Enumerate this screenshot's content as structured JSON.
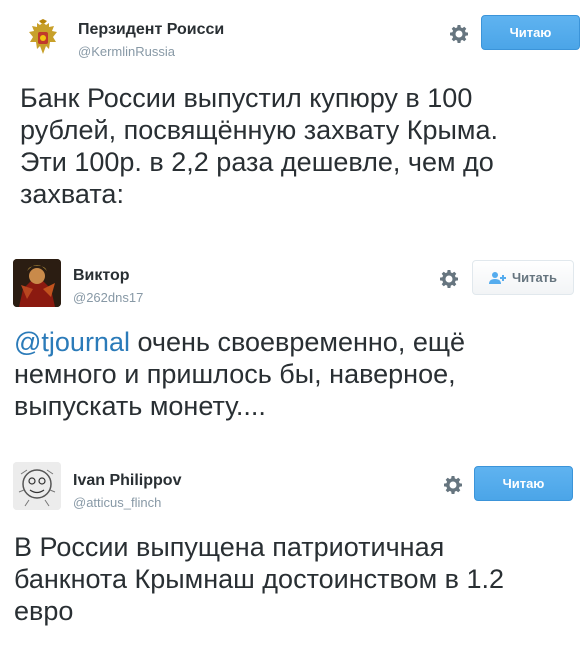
{
  "tweets": [
    {
      "name": "Перзидент Роисси",
      "handle": "@KermlinRussia",
      "button": "Читаю",
      "text": "Банк России выпустил купюру в 100\nрублей, посвящённую захвату Крыма.\nЭти 100р. в 2,2 раза дешевле, чем до\nзахвата:",
      "avatar_icon": "coat-of-arms-icon"
    },
    {
      "name": "Виктор",
      "handle": "@262dns17",
      "button": "Читать",
      "mention": "@tjournal",
      "text": " очень своевременно, ещё\nнемного и пришлось бы, наверное,\nвыпускать монету....",
      "avatar_icon": "portrait-avatar-icon"
    },
    {
      "name": "Ivan Philippov",
      "handle": "@atticus_flinch",
      "button": "Читаю",
      "text": "В России выпущена патриотичная\nбанкнота Крымнаш достоинством в 1.2\nевро",
      "avatar_icon": "sketch-avatar-icon"
    }
  ],
  "colors": {
    "following_button": "#55acee",
    "mention": "#2b7bb9",
    "handle": "#8899a6"
  }
}
